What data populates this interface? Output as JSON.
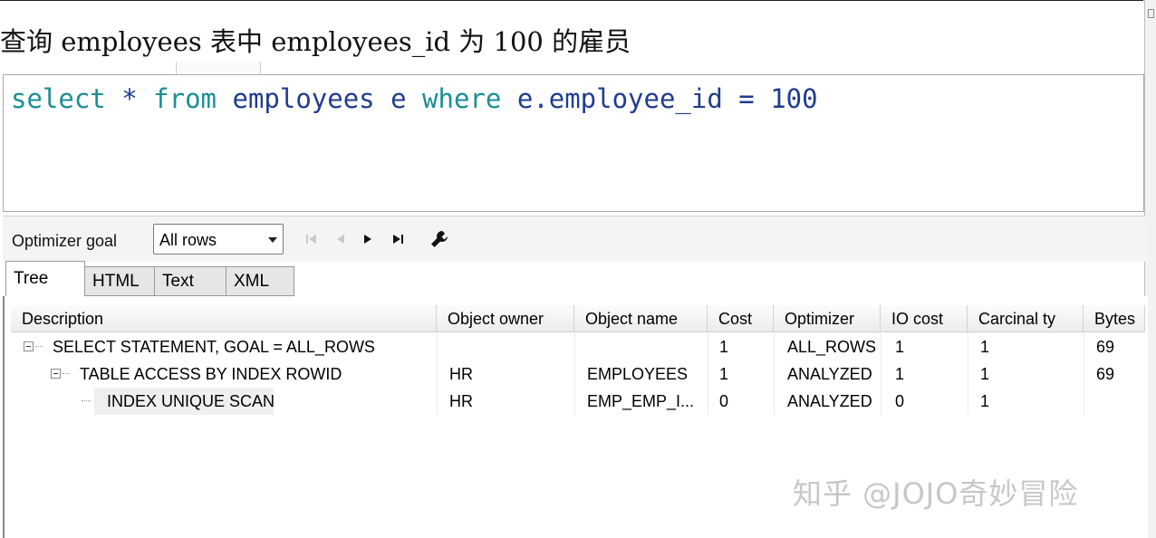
{
  "caption": "查询 employees 表中 employees_id 为 100 的雇员",
  "editor": {
    "sql_tokens": [
      {
        "t": "select",
        "c": "kw"
      },
      {
        "t": " ",
        "c": ""
      },
      {
        "t": "*",
        "c": "op"
      },
      {
        "t": " ",
        "c": ""
      },
      {
        "t": "from",
        "c": "kw"
      },
      {
        "t": " ",
        "c": ""
      },
      {
        "t": "employees",
        "c": "ident"
      },
      {
        "t": " ",
        "c": ""
      },
      {
        "t": "e",
        "c": "ident"
      },
      {
        "t": " ",
        "c": ""
      },
      {
        "t": "where",
        "c": "kw"
      },
      {
        "t": " ",
        "c": ""
      },
      {
        "t": "e.employee_id",
        "c": "ident"
      },
      {
        "t": " ",
        "c": ""
      },
      {
        "t": "=",
        "c": "op"
      },
      {
        "t": " ",
        "c": ""
      },
      {
        "t": "100",
        "c": "num"
      }
    ]
  },
  "toolbar": {
    "optimizer_label": "Optimizer goal",
    "optimizer_value": "All rows",
    "icons": [
      "first-icon",
      "prev-icon",
      "next-icon",
      "last-icon",
      "wrench-icon"
    ]
  },
  "tabs": [
    {
      "label": "Tree",
      "active": true
    },
    {
      "label": "HTML",
      "active": false
    },
    {
      "label": "Text",
      "active": false
    },
    {
      "label": "XML",
      "active": false
    }
  ],
  "grid": {
    "columns": [
      "Description",
      "Object owner",
      "Object name",
      "Cost",
      "Optimizer",
      "IO cost",
      "Carcinal ty",
      "Bytes"
    ],
    "rows": [
      {
        "description": "SELECT STATEMENT, GOAL = ALL_ROWS",
        "owner": "",
        "name": "",
        "cost": "1",
        "optimizer": "ALL_ROWS",
        "io_cost": "1",
        "cardinality": "1",
        "bytes": "69",
        "depth": 0,
        "expandable": true
      },
      {
        "description": "TABLE ACCESS BY INDEX ROWID",
        "owner": "HR",
        "name": "EMPLOYEES",
        "cost": "1",
        "optimizer": "ANALYZED",
        "io_cost": "1",
        "cardinality": "1",
        "bytes": "69",
        "depth": 1,
        "expandable": true
      },
      {
        "description": "INDEX UNIQUE SCAN",
        "owner": "HR",
        "name": "EMP_EMP_I...",
        "cost": "0",
        "optimizer": "ANALYZED",
        "io_cost": "0",
        "cardinality": "1",
        "bytes": "",
        "depth": 2,
        "expandable": false
      }
    ]
  },
  "watermark": "知乎 @JOJO奇妙冒险"
}
